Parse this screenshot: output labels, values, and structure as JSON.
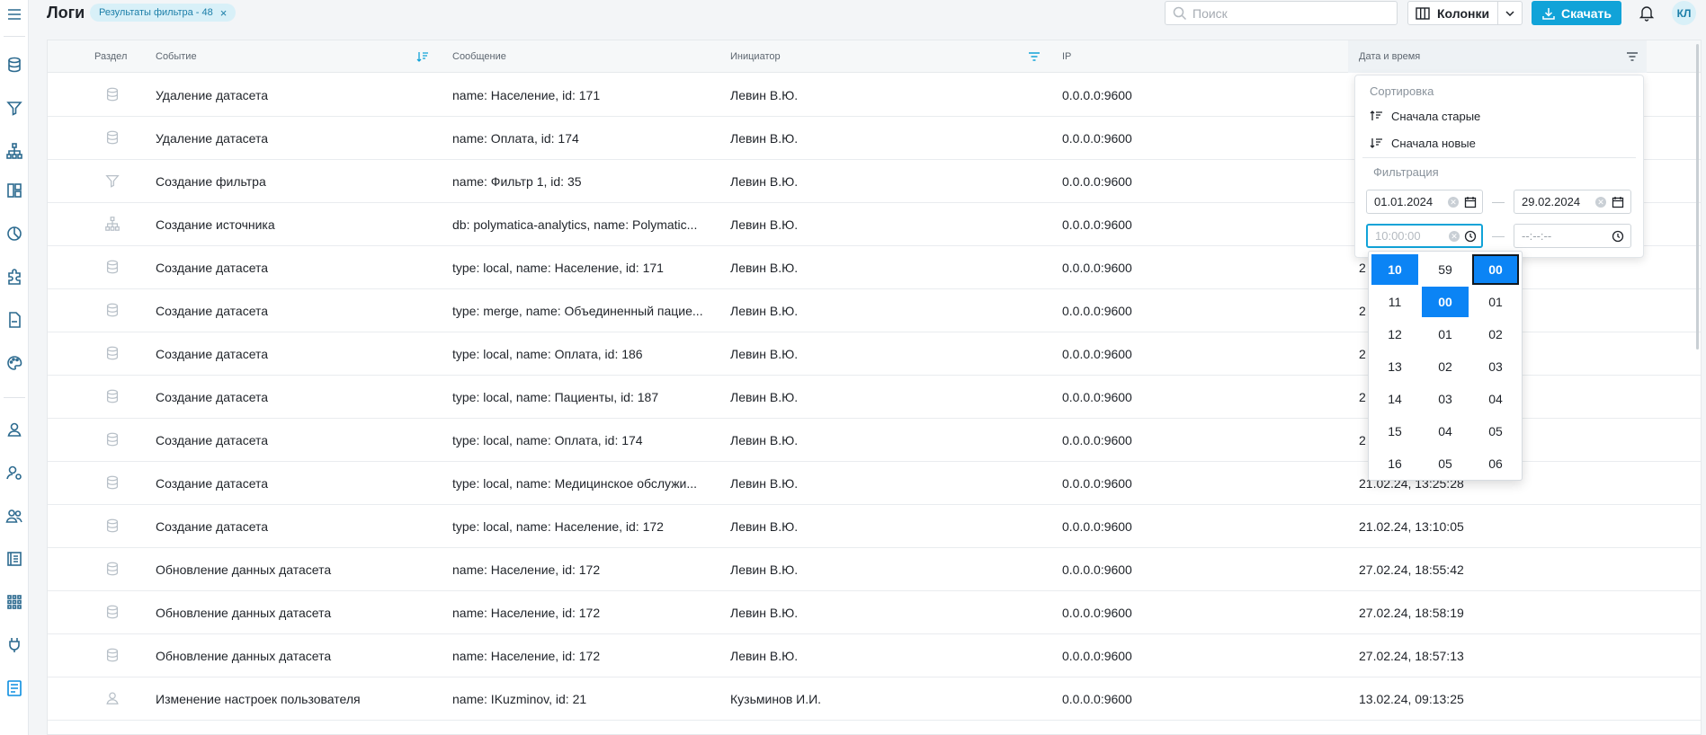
{
  "header": {
    "title": "Логи",
    "filter_chip": "Результаты фильтра - 48",
    "search_placeholder": "Поиск",
    "columns_label": "Колонки",
    "download_label": "Скачать",
    "avatar_initials": "КЛ"
  },
  "colors": {
    "accent": "#11a3d8",
    "selected": "#0b84f5"
  },
  "table": {
    "columns": [
      "Раздел",
      "Событие",
      "Сообщение",
      "Инициатор",
      "IP",
      "Дата и время"
    ],
    "rows": [
      {
        "icon": "database-icon",
        "event": "Удаление датасета",
        "message": "name: Население, id: 171",
        "initiator": "Левин В.Ю.",
        "ip": "0.0.0.0:9600",
        "date": ""
      },
      {
        "icon": "database-icon",
        "event": "Удаление датасета",
        "message": "name: Оплата, id: 174",
        "initiator": "Левин В.Ю.",
        "ip": "0.0.0.0:9600",
        "date": ""
      },
      {
        "icon": "filter-icon",
        "event": "Создание фильтра",
        "message": "name: Фильтр 1, id: 35",
        "initiator": "Левин В.Ю.",
        "ip": "0.0.0.0:9600",
        "date": ""
      },
      {
        "icon": "sitemap-icon",
        "event": "Создание источника",
        "message": "db: polymatica-analytics, name: Polymatic...",
        "initiator": "Левин В.Ю.",
        "ip": "0.0.0.0:9600",
        "date": ""
      },
      {
        "icon": "database-icon",
        "event": "Создание датасета",
        "message": "type: local, name: Население, id: 171",
        "initiator": "Левин В.Ю.",
        "ip": "0.0.0.0:9600",
        "date": "2"
      },
      {
        "icon": "database-icon",
        "event": "Создание датасета",
        "message": "type: merge, name: Объединенный пацие...",
        "initiator": "Левин В.Ю.",
        "ip": "0.0.0.0:9600",
        "date": "2"
      },
      {
        "icon": "database-icon",
        "event": "Создание датасета",
        "message": "type: local, name: Оплата, id: 186",
        "initiator": "Левин В.Ю.",
        "ip": "0.0.0.0:9600",
        "date": "2"
      },
      {
        "icon": "database-icon",
        "event": "Создание датасета",
        "message": "type: local, name: Пациенты, id: 187",
        "initiator": "Левин В.Ю.",
        "ip": "0.0.0.0:9600",
        "date": "2"
      },
      {
        "icon": "database-icon",
        "event": "Создание датасета",
        "message": "type: local, name: Оплата, id: 174",
        "initiator": "Левин В.Ю.",
        "ip": "0.0.0.0:9600",
        "date": "2"
      },
      {
        "icon": "database-icon",
        "event": "Создание датасета",
        "message": "type: local, name: Медицинское обслужи...",
        "initiator": "Левин В.Ю.",
        "ip": "0.0.0.0:9600",
        "date": "21.02.24, 13:25:28"
      },
      {
        "icon": "database-icon",
        "event": "Создание датасета",
        "message": "type: local, name: Население, id: 172",
        "initiator": "Левин В.Ю.",
        "ip": "0.0.0.0:9600",
        "date": "21.02.24, 13:10:05"
      },
      {
        "icon": "database-icon",
        "event": "Обновление данных датасета",
        "message": "name: Население, id: 172",
        "initiator": "Левин В.Ю.",
        "ip": "0.0.0.0:9600",
        "date": "27.02.24, 18:55:42"
      },
      {
        "icon": "database-icon",
        "event": "Обновление данных датасета",
        "message": "name: Население, id: 172",
        "initiator": "Левин В.Ю.",
        "ip": "0.0.0.0:9600",
        "date": "27.02.24, 18:58:19"
      },
      {
        "icon": "database-icon",
        "event": "Обновление данных датасета",
        "message": "name: Население, id: 172",
        "initiator": "Левин В.Ю.",
        "ip": "0.0.0.0:9600",
        "date": "27.02.24, 18:57:13"
      },
      {
        "icon": "user-icon",
        "event": "Изменение настроек пользователя",
        "message": "name: IKuzminov, id: 21",
        "initiator": "Кузьминов И.И.",
        "ip": "0.0.0.0:9600",
        "date": "13.02.24, 09:13:25"
      }
    ]
  },
  "popup": {
    "sort_label": "Сортировка",
    "sort_oldest": "Сначала старые",
    "sort_newest": "Сначала новые",
    "filter_label": "Фильтрация",
    "date_from": "01.01.2024",
    "date_to": "29.02.2024",
    "time_from": "10:00:00",
    "time_to": "--:--:--"
  },
  "timepicker": {
    "hours": [
      "10",
      "11",
      "12",
      "13",
      "14",
      "15",
      "16"
    ],
    "minutes": [
      "59",
      "00",
      "01",
      "02",
      "03",
      "04",
      "05"
    ],
    "seconds": [
      "00",
      "01",
      "02",
      "03",
      "04",
      "05",
      "06"
    ],
    "selected_hour": "10",
    "selected_minute": "00",
    "selected_second": "00"
  }
}
